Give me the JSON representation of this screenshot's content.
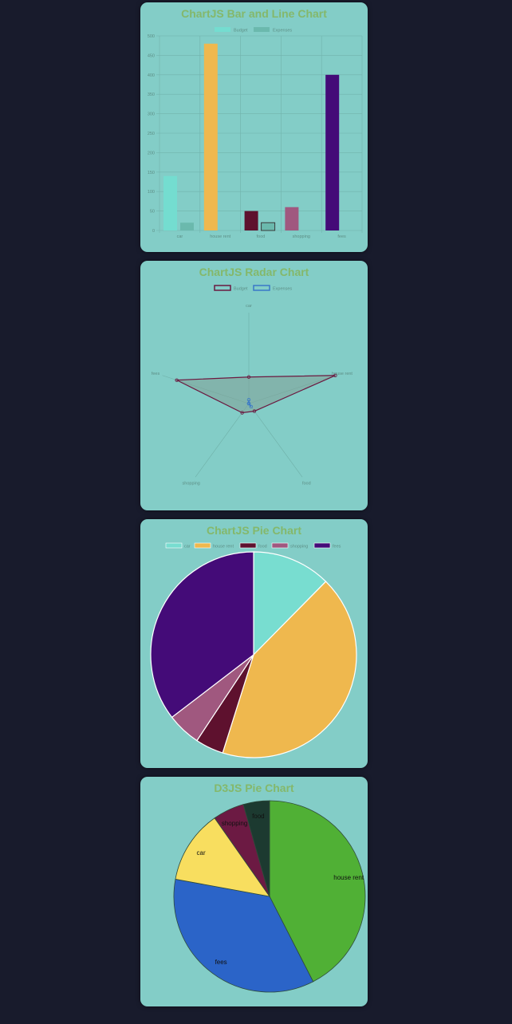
{
  "page": {
    "background": "#181b2c",
    "card_background": "#83cdc7",
    "title_color": "#84b86b"
  },
  "bar_card": {
    "title": "ChartJS Bar and Line Chart"
  },
  "radar_card": {
    "title": "ChartJS Radar Chart"
  },
  "pie_card": {
    "title": "ChartJS Pie Chart"
  },
  "d3_card": {
    "title": "D3JS Pie Chart"
  },
  "chart_data": [
    {
      "type": "bar",
      "categories": [
        "car",
        "house rent",
        "food",
        "shopping",
        "fees"
      ],
      "series": [
        {
          "name": "Budget",
          "values": [
            140,
            480,
            50,
            60,
            400
          ],
          "colors": [
            "#74ddd0",
            "#efb84e",
            "#5e112e",
            "#a0587f",
            "#440b78"
          ]
        },
        {
          "name": "Expenses",
          "values": [
            20,
            0,
            20,
            0,
            0
          ],
          "color": "#6bb9ad"
        }
      ],
      "ylim": [
        0,
        500
      ],
      "yticks": [
        0,
        50,
        100,
        150,
        200,
        250,
        300,
        350,
        400,
        450,
        500
      ],
      "grid": true,
      "legend": "top"
    },
    {
      "type": "radar",
      "categories": [
        "car",
        "house rent",
        "food",
        "shopping",
        "fees"
      ],
      "series": [
        {
          "name": "Budget",
          "values": [
            140,
            480,
            50,
            60,
            400
          ],
          "color": "#6b1940"
        },
        {
          "name": "Expenses",
          "values": [
            20,
            0,
            20,
            0,
            0
          ],
          "color": "#3a78c8"
        }
      ],
      "rmax": 480,
      "legend": "top"
    },
    {
      "type": "pie",
      "categories": [
        "car",
        "house rent",
        "food",
        "shopping",
        "fees"
      ],
      "values": [
        140,
        480,
        50,
        60,
        400
      ],
      "colors": [
        "#78ddd0",
        "#efb84e",
        "#5e112e",
        "#a0587f",
        "#440b78"
      ],
      "legend": "top"
    },
    {
      "type": "pie",
      "categories": [
        "house rent",
        "fees",
        "car",
        "shopping",
        "food"
      ],
      "values": [
        480,
        400,
        140,
        60,
        50
      ],
      "colors": [
        "#50b035",
        "#2b64c8",
        "#f8de5f",
        "#6c1a43",
        "#1c3a30"
      ]
    }
  ]
}
